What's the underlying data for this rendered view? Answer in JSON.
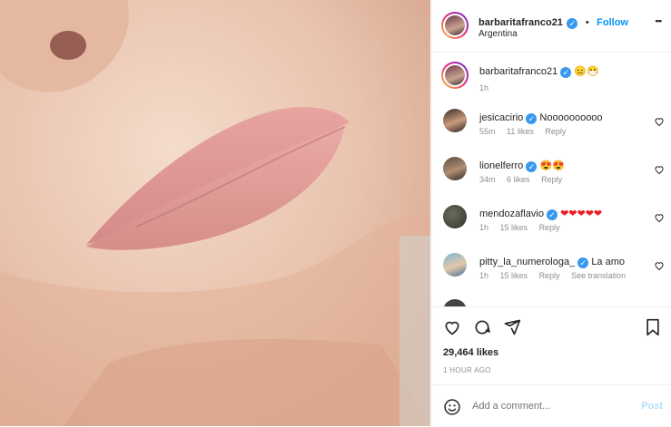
{
  "post": {
    "username": "barbaritafranco21",
    "location": "Argentina",
    "follow_label": "Follow",
    "dot": "•",
    "more_label": "•••",
    "caption_emojis": "😑😷",
    "caption_time": "1h"
  },
  "comments": [
    {
      "username": "jesicacirio",
      "verified": true,
      "text": "Noooooooooo",
      "time": "55m",
      "likes": "11 likes",
      "reply": "Reply",
      "extra": ""
    },
    {
      "username": "lionelferro",
      "verified": true,
      "text": "😍😍",
      "time": "34m",
      "likes": "6 likes",
      "reply": "Reply",
      "extra": ""
    },
    {
      "username": "mendozaflavio",
      "verified": true,
      "text": "❤❤❤❤❤",
      "time": "1h",
      "likes": "15 likes",
      "reply": "Reply",
      "extra": ""
    },
    {
      "username": "pitty_la_numerologa_",
      "verified": true,
      "text": "La amo",
      "time": "1h",
      "likes": "15 likes",
      "reply": "Reply",
      "extra": "See translation"
    }
  ],
  "stats": {
    "likes": "29,464 likes",
    "time_ago": "1 HOUR AGO"
  },
  "add_comment": {
    "placeholder": "Add a comment...",
    "post_label": "Post"
  },
  "colors": {
    "accent": "#0095f6",
    "verified": "#3897f0",
    "heart_red": "#ed4956"
  }
}
